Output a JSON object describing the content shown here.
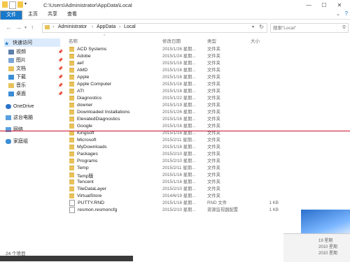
{
  "window": {
    "title": "C:\\Users\\Administrator\\AppData\\Local"
  },
  "ribbon": {
    "tabs": [
      "文件",
      "主页",
      "共享",
      "查看"
    ]
  },
  "nav": {
    "back": "←",
    "forward": "→",
    "up": "↑"
  },
  "address": {
    "crumbs": [
      "Administrator",
      "AppData",
      "Local"
    ],
    "separator": "›"
  },
  "search": {
    "placeholder": "搜索\"Local\""
  },
  "sidebar": {
    "quick_access": "快速访问",
    "pinned": [
      "视频",
      "图片",
      "文档",
      "下载",
      "音乐",
      "桌面"
    ],
    "onedrive": "OneDrive",
    "this_pc": "这台电脑",
    "network": "网络",
    "homegroup": "家庭组"
  },
  "columns": {
    "name": "名称",
    "date": "修改日期",
    "type": "类型",
    "size": "大小"
  },
  "files": [
    {
      "name": "ACD Systems",
      "date": "2015/1/26 星期...",
      "type": "文件夹",
      "size": "",
      "kind": "folder"
    },
    {
      "name": "Adobe",
      "date": "2015/1/24 星期...",
      "type": "文件夹",
      "size": "",
      "kind": "folder"
    },
    {
      "name": "aef",
      "date": "2015/1/16 星期...",
      "type": "文件夹",
      "size": "",
      "kind": "folder"
    },
    {
      "name": "AMD",
      "date": "2015/1/16 星期...",
      "type": "文件夹",
      "size": "",
      "kind": "folder"
    },
    {
      "name": "Apple",
      "date": "2015/1/16 星期...",
      "type": "文件夹",
      "size": "",
      "kind": "folder"
    },
    {
      "name": "Apple Computer",
      "date": "2015/1/16 星期...",
      "type": "文件夹",
      "size": "",
      "kind": "folder"
    },
    {
      "name": "ATI",
      "date": "2015/1/16 星期...",
      "type": "文件夹",
      "size": "",
      "kind": "folder"
    },
    {
      "name": "Diagnostics",
      "date": "2015/1/22 星期...",
      "type": "文件夹",
      "size": "",
      "kind": "folder"
    },
    {
      "name": "downer",
      "date": "2015/1/19 星期...",
      "type": "文件夹",
      "size": "",
      "kind": "folder"
    },
    {
      "name": "Downloaded Installations",
      "date": "2015/1/26 星期...",
      "type": "文件夹",
      "size": "",
      "kind": "folder"
    },
    {
      "name": "ElevatedDiagnostics",
      "date": "2015/1/16 星期...",
      "type": "文件夹",
      "size": "",
      "kind": "folder"
    },
    {
      "name": "Google",
      "date": "2015/1/16 星期...",
      "type": "文件夹",
      "size": "",
      "kind": "folder"
    },
    {
      "name": "Kingsoft",
      "date": "2015/1/16 星期...",
      "type": "文件夹",
      "size": "",
      "kind": "folder"
    },
    {
      "name": "Microsoft",
      "date": "2015/2/11 星期...",
      "type": "文件夹",
      "size": "",
      "kind": "folder"
    },
    {
      "name": "MyDownloads",
      "date": "2015/1/16 星期...",
      "type": "文件夹",
      "size": "",
      "kind": "folder"
    },
    {
      "name": "Packages",
      "date": "2015/2/10 星期...",
      "type": "文件夹",
      "size": "",
      "kind": "folder"
    },
    {
      "name": "Programs",
      "date": "2015/2/10 星期...",
      "type": "文件夹",
      "size": "",
      "kind": "folder"
    },
    {
      "name": "Temp",
      "date": "2015/2/11 星期...",
      "type": "文件夹",
      "size": "",
      "kind": "folder"
    },
    {
      "name": "Temp版",
      "date": "2015/1/16 星期...",
      "type": "文件夹",
      "size": "",
      "kind": "folder"
    },
    {
      "name": "Tencent",
      "date": "2015/1/16 星期...",
      "type": "文件夹",
      "size": "",
      "kind": "folder"
    },
    {
      "name": "TileDataLayer",
      "date": "2015/2/10 星期...",
      "type": "文件夹",
      "size": "",
      "kind": "folder"
    },
    {
      "name": "VirtualStore",
      "date": "2014/6/19 星期...",
      "type": "文件夹",
      "size": "",
      "kind": "folder"
    },
    {
      "name": "PUTTY.RND",
      "date": "2015/1/16 星期...",
      "type": "RND 文件",
      "size": "1 KB",
      "kind": "file"
    },
    {
      "name": "resmon.resmoncfg",
      "date": "2015/2/10 星期...",
      "type": "资源监视器配置",
      "size": "1 KB",
      "kind": "file"
    }
  ],
  "status": {
    "count": "24 个项目"
  },
  "overlay": {
    "right_fragments": [
      "19 星期",
      "2010 星期",
      "2010 星期"
    ]
  },
  "colors": {
    "accent": "#1979ca",
    "folder": "#e7c25a",
    "annotation_line": "#c8102e"
  }
}
